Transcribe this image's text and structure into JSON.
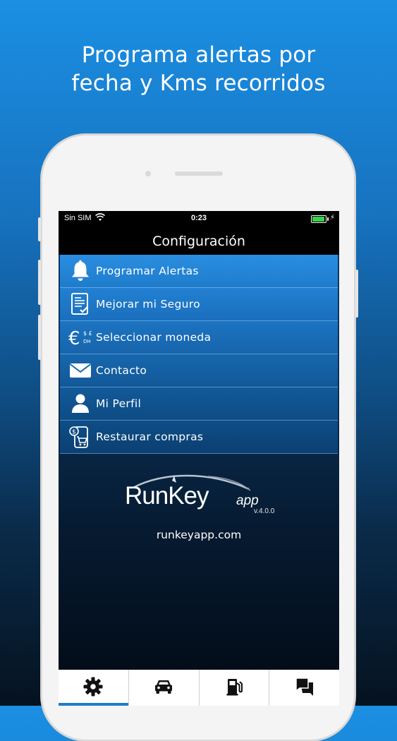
{
  "headline": {
    "line1": "Programa alertas por",
    "line2": "fecha y Kms recorridos"
  },
  "status_bar": {
    "carrier": "Sin SIM",
    "time": "0:23"
  },
  "nav": {
    "title": "Configuración"
  },
  "menu": {
    "items": [
      {
        "label": "Programar Alertas",
        "icon": "bell-icon"
      },
      {
        "label": "Mejorar mi Seguro",
        "icon": "document-icon"
      },
      {
        "label": "Seleccionar moneda",
        "icon": "currency-icon"
      },
      {
        "label": "Contacto",
        "icon": "envelope-icon"
      },
      {
        "label": "Mi Perfil",
        "icon": "user-icon"
      },
      {
        "label": "Restaurar compras",
        "icon": "purchase-restore-icon"
      }
    ]
  },
  "brand": {
    "logo_main": "RunKey",
    "logo_suffix": "app",
    "version": "v.4.0.0",
    "website": "runkeyapp.com"
  },
  "tabbar": {
    "tabs": [
      {
        "icon": "gear-icon",
        "active": true
      },
      {
        "icon": "car-icon",
        "active": false
      },
      {
        "icon": "fuel-pump-icon",
        "active": false
      },
      {
        "icon": "chat-icon",
        "active": false
      }
    ]
  },
  "colors": {
    "accent": "#1f7ccc",
    "battery": "#3ad14b"
  }
}
